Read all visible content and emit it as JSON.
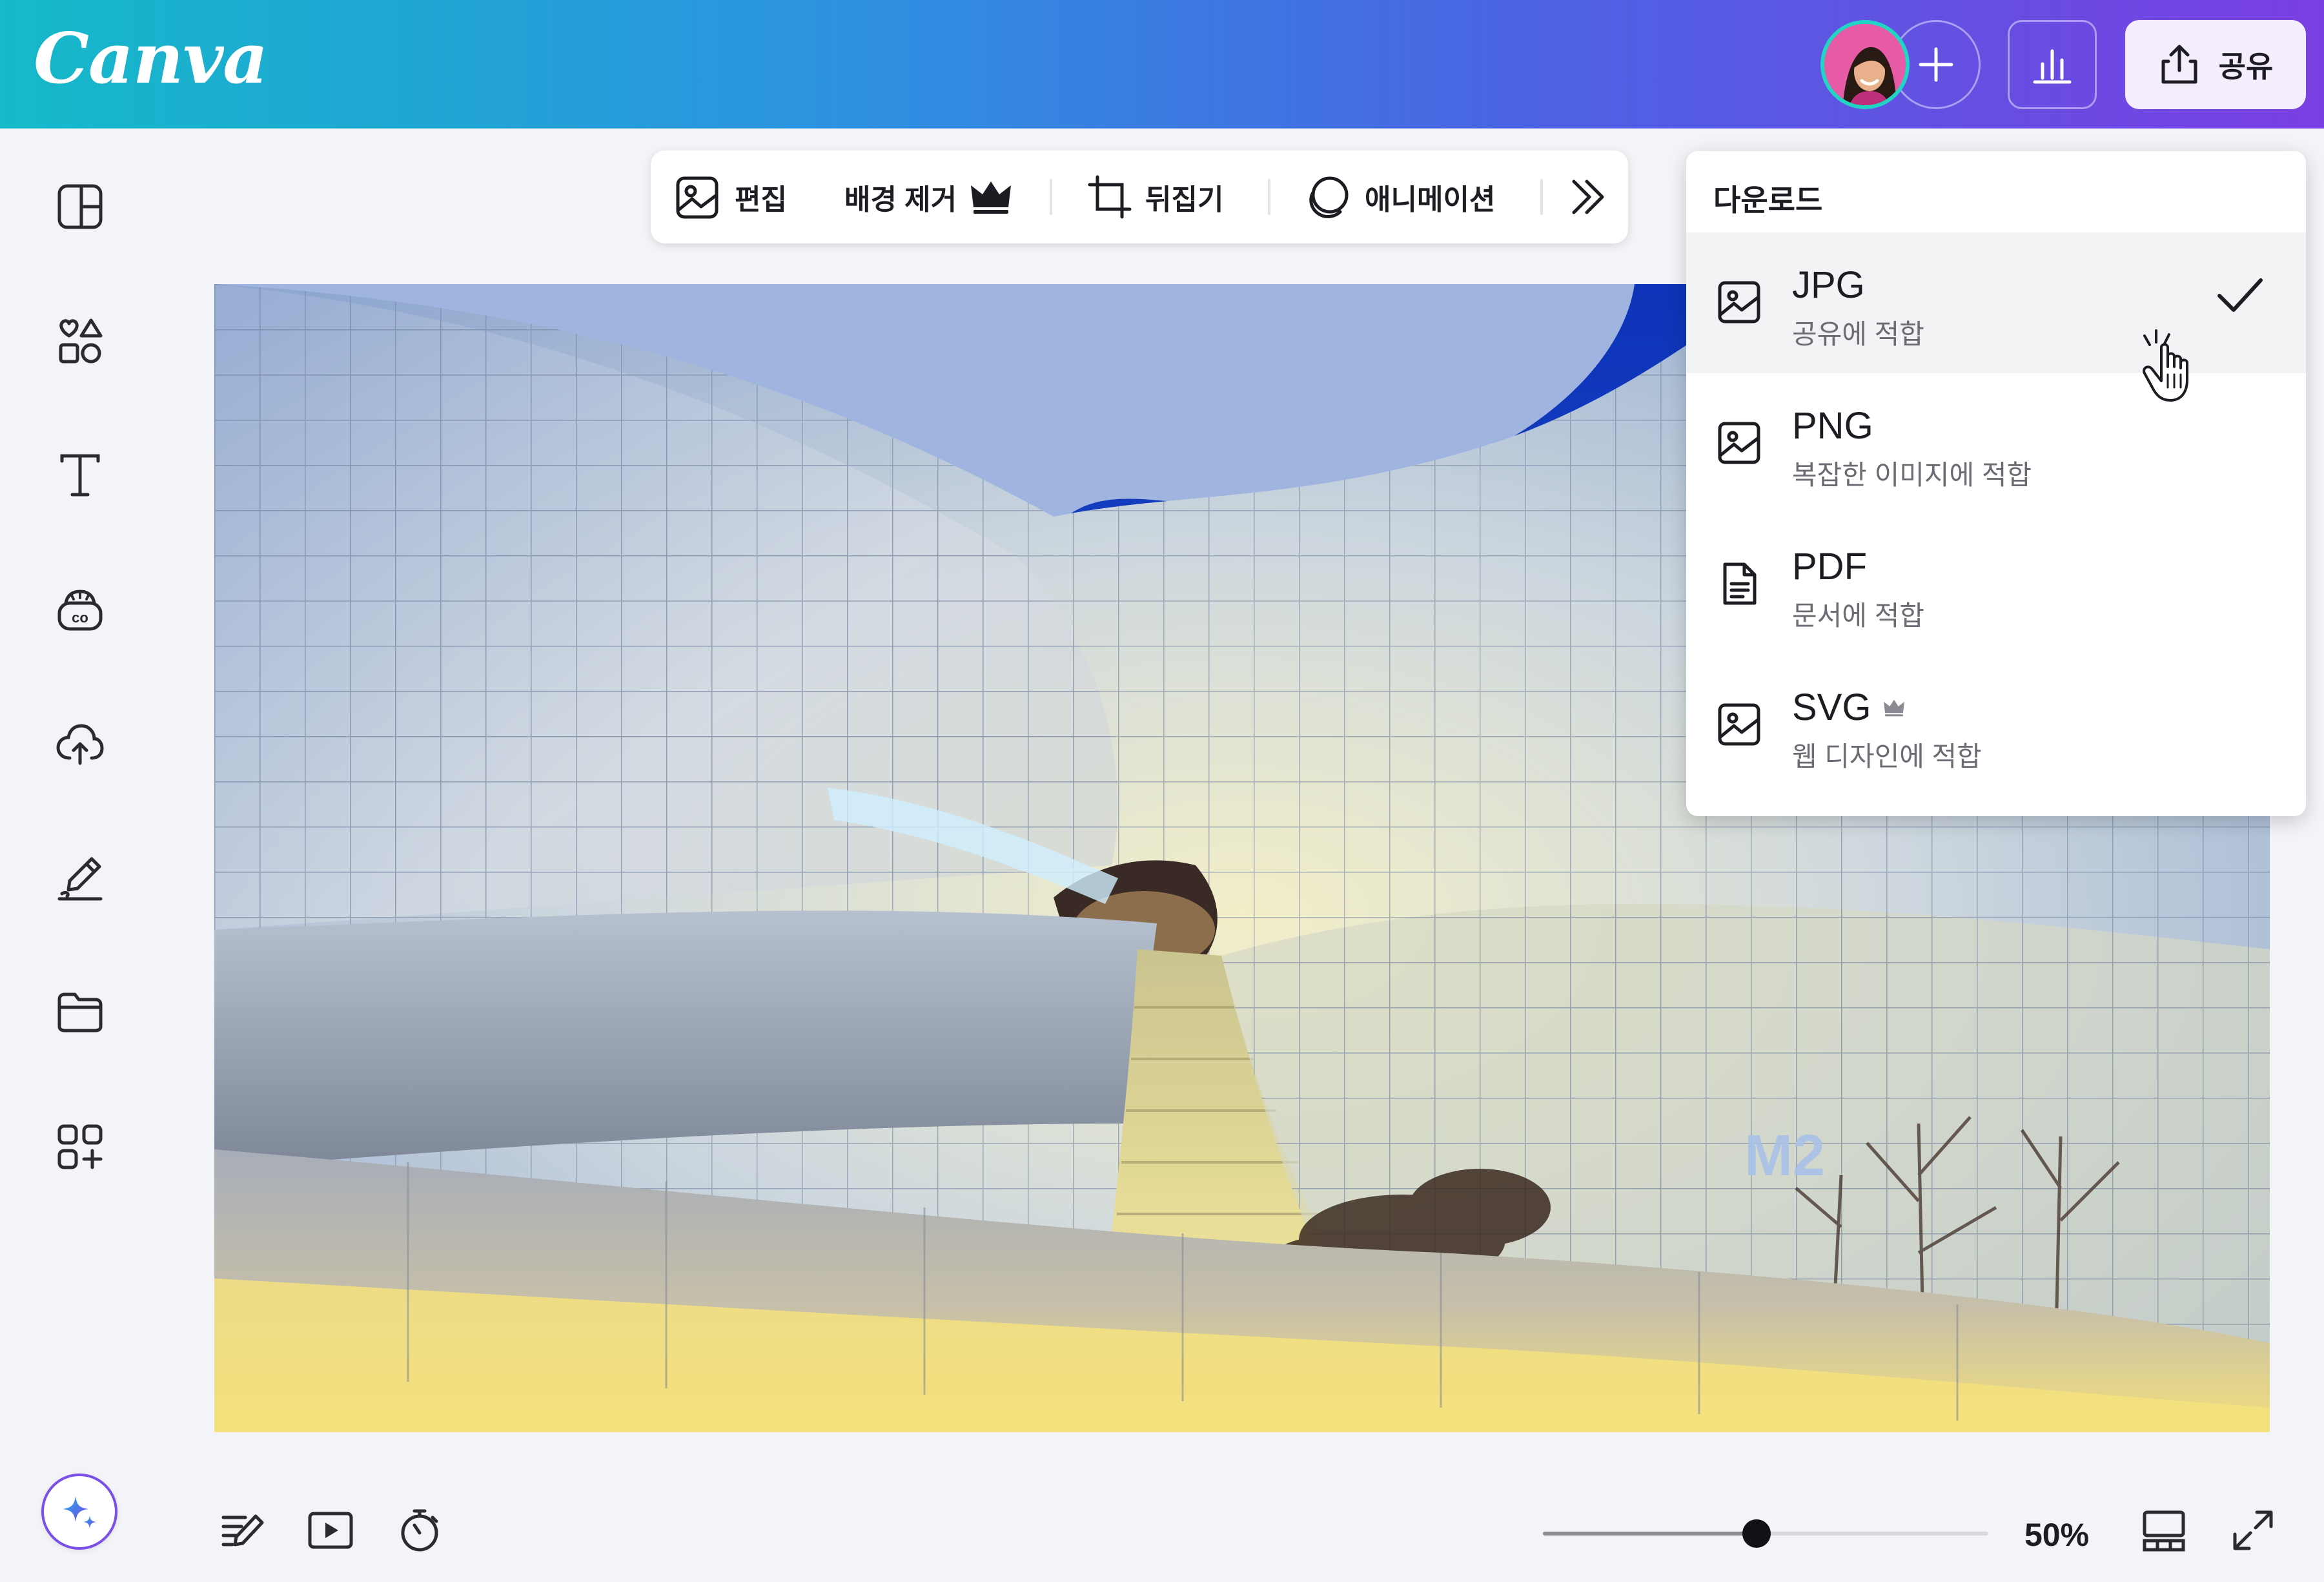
{
  "header": {
    "logo": "Canva",
    "share_label": "공유",
    "accent_gradient": [
      "#15b9c9",
      "#2c93df",
      "#4a64e3",
      "#7a3fe2"
    ],
    "icons": [
      "avatar",
      "plus-icon",
      "bar-chart-icon",
      "share-upload-icon"
    ]
  },
  "sidebar": {
    "items": [
      {
        "icon": "design-panel-icon"
      },
      {
        "icon": "elements-icon"
      },
      {
        "icon": "text-icon"
      },
      {
        "icon": "brand-icon"
      },
      {
        "icon": "uploads-cloud-icon"
      },
      {
        "icon": "draw-icon"
      },
      {
        "icon": "projects-folder-icon"
      },
      {
        "icon": "apps-icon"
      }
    ],
    "magic_icon": "sparkle-icon"
  },
  "toolbar": {
    "edit_label": "편집",
    "bg_remove_label": "배경 제거",
    "flip_label": "뒤집기",
    "animate_label": "애니메이션",
    "more_icon": "double-chevron-right-icon"
  },
  "download_menu": {
    "title": "다운로드",
    "options": [
      {
        "name": "JPG",
        "description": "공유에 적합",
        "icon": "image-icon",
        "selected": true
      },
      {
        "name": "PNG",
        "description": "복잡한 이미지에 적합",
        "icon": "image-icon",
        "selected": false
      },
      {
        "name": "PDF",
        "description": "문서에 적합",
        "icon": "document-icon",
        "selected": false
      },
      {
        "name": "SVG",
        "description": "웹 디자인에 적합",
        "icon": "image-icon",
        "selected": false,
        "premium": true
      }
    ]
  },
  "canvas": {
    "image_text": "M2"
  },
  "bottom_bar": {
    "icons": [
      "notes-icon",
      "present-icon",
      "timer-icon",
      "grid-view-icon",
      "fullscreen-icon"
    ],
    "zoom_label": "50%",
    "zoom_value": 0.48
  }
}
